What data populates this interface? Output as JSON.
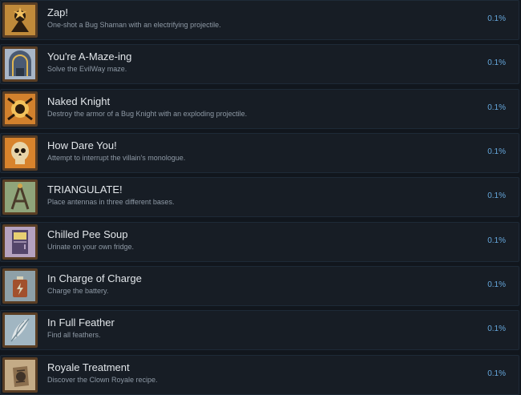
{
  "achievements": [
    {
      "title": "Zap!",
      "description": "One-shot a Bug Shaman with an electrifying projectile.",
      "percent": "0.1%",
      "icon": "shaman-icon",
      "palette": [
        "#c08a3a",
        "#2b1d10",
        "#f2c060"
      ]
    },
    {
      "title": "You're A-Maze-ing",
      "description": "Solve the EvilWay maze.",
      "percent": "0.1%",
      "icon": "maze-arch-icon",
      "palette": [
        "#a8b6c8",
        "#4a5a73",
        "#e1b652"
      ]
    },
    {
      "title": "Naked Knight",
      "description": "Destroy the armor of a Bug Knight with an exploding projectile.",
      "percent": "0.1%",
      "icon": "knight-icon",
      "palette": [
        "#d2812d",
        "#2a1a0c",
        "#f3c15a"
      ]
    },
    {
      "title": "How Dare You!",
      "description": "Attempt to interrupt the villain's monologue.",
      "percent": "0.1%",
      "icon": "skull-icon",
      "palette": [
        "#d8832c",
        "#1d130a",
        "#e8d4a8"
      ]
    },
    {
      "title": "TRIANGULATE!",
      "description": "Place antennas in three different bases.",
      "percent": "0.1%",
      "icon": "antenna-icon",
      "palette": [
        "#8fa47a",
        "#4b3b2a",
        "#d2a54a"
      ]
    },
    {
      "title": "Chilled Pee Soup",
      "description": "Urinate on your own fridge.",
      "percent": "0.1%",
      "icon": "fridge-icon",
      "palette": [
        "#b5a2c0",
        "#54456a",
        "#e7cf72"
      ]
    },
    {
      "title": "In Charge of Charge",
      "description": "Charge the battery.",
      "percent": "0.1%",
      "icon": "battery-icon",
      "palette": [
        "#8ea0a8",
        "#a2502c",
        "#d9d2b8"
      ]
    },
    {
      "title": "In Full Feather",
      "description": "Find all feathers.",
      "percent": "0.1%",
      "icon": "feather-icon",
      "palette": [
        "#a1b6c2",
        "#6f8793",
        "#e0e6e8"
      ]
    },
    {
      "title": "Royale Treatment",
      "description": "Discover the Clown Royale recipe.",
      "percent": "0.1%",
      "icon": "recipe-icon",
      "palette": [
        "#c4ab86",
        "#403328",
        "#8c6f4e"
      ]
    }
  ]
}
